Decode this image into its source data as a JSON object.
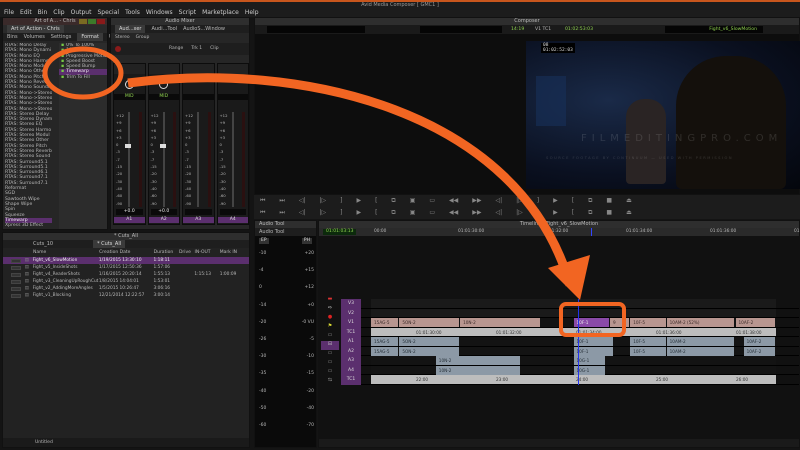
{
  "app": {
    "title": "Avid Media Composer [ GMC1 ]"
  },
  "menu": [
    "File",
    "Edit",
    "Bin",
    "Clip",
    "Output",
    "Special",
    "Tools",
    "Windows",
    "Script",
    "Marketplace",
    "Help"
  ],
  "effects_panel": {
    "title": "Art of A... - Chris",
    "tab": "Art of Action - Chris",
    "tabs": [
      "Bins",
      "Volumes",
      "Settings",
      "Format",
      "Us"
    ],
    "categories": [
      "RTAS: Mono Delay",
      "RTAS: Mono Dynami",
      "RTAS: Mono EQ",
      "RTAS: Mono Harmon",
      "RTAS: Mono Modul",
      "RTAS: Mono Other",
      "RTAS: Mono Pitch",
      "RTAS: Mono Reverb",
      "RTAS: Mono SoundF",
      "RTAS: Mono->Stereo",
      "RTAS: Mono->Stereo",
      "RTAS: Mono->Stereo",
      "RTAS: Mono->Stereo",
      "RTAS: Stereo Delay",
      "RTAS: Stereo Dynam",
      "RTAS: Stereo EQ",
      "RTAS: Stereo Harmo",
      "RTAS: Stereo Modul",
      "RTAS: Stereo Other",
      "RTAS: Stereo Pitch",
      "RTAS: Stereo Reverb",
      "RTAS: Stereo Sound",
      "RTAS: Surround5.1",
      "RTAS: Surround5.1",
      "RTAS: Surround6.1",
      "RTAS: Surround7.1",
      "RTAS: Surround7.1",
      "Reformat",
      "SGD",
      "Sawtooth Wipe",
      "Shape Wipe",
      "Spin",
      "Squeeze",
      "Timewarp",
      "Xpress 3D Effect"
    ],
    "selected_category": "Timewarp",
    "effects": [
      "0% To 100%",
      "100% To 0%",
      "Progressive Motion",
      "Speed Boost",
      "Speed Bump",
      "Timewarp",
      "Trim To Fill"
    ],
    "selected_effect": "Timewarp"
  },
  "audio_mixer": {
    "title": "Audio Mixer",
    "tabs": [
      "Aud...xer",
      "Audi...Tool",
      "AudioS...Window"
    ],
    "stereo_label": "Stereo",
    "group_label": "Group",
    "range_label": "Range",
    "trk_label": "Trk 1",
    "clip_label": "Clip",
    "channels": [
      {
        "pan": "MID",
        "gain": "+0.0",
        "name": "A1"
      },
      {
        "pan": "MID",
        "gain": "+0.0",
        "name": "A2"
      },
      {
        "pan": "",
        "gain": "",
        "name": "A3"
      },
      {
        "pan": "",
        "gain": "",
        "name": "A4"
      }
    ],
    "scale": [
      "+12",
      "+9",
      "+6",
      "+3",
      "0",
      "-3",
      "-7",
      "-15",
      "-20",
      "-30",
      "-40",
      "-60",
      "-90"
    ]
  },
  "composer": {
    "title": "Composer",
    "time": "14:19",
    "track": "V1 TC1",
    "timecode": "01:02:53:03",
    "sequence": "Fight_v6_SlowMotion",
    "overlay_frame": "08",
    "overlay_tc": "01:02:52:03",
    "watermark": "FILMEDITINGPRO.COM",
    "watermark_sub": "SOURCE FOOTAGE BY CONTINUUM — USED WITH PERMISSION"
  },
  "bin": {
    "title": "* Cuts_All",
    "tabs": [
      "Cuts_10",
      "* Cuts_All"
    ],
    "columns": [
      "Name",
      "Creation Date",
      "Duration",
      "Drive",
      "IN-OUT",
      "Mark IN"
    ],
    "rows": [
      [
        "Fight_v6_SlowMotion",
        "1/19/2015 13:30:10",
        "1:18:11",
        "",
        "",
        ""
      ],
      [
        "Fight_v5_InsideShots",
        "1/17/2015 12:50:36",
        "1:57:06",
        "",
        "",
        ""
      ],
      [
        "Fight_v4_ReaderShots",
        "1/16/2015 20:20:14",
        "1:55:13",
        "",
        "1:15:13",
        "1:00:09"
      ],
      [
        "Fight_v3_CleaningUpRoughCut",
        "1/8/2015 14:04:01",
        "1:53:01",
        "",
        "",
        ""
      ],
      [
        "Fight_v2_AddingMoreAngles",
        "1/5/2015 10:26:47",
        "3:06:16",
        "",
        "",
        ""
      ],
      [
        "Fight_v1_Blocking",
        "12/21/2014 12:22:57",
        "3:00:14",
        "",
        "",
        ""
      ]
    ],
    "view": "Untitled"
  },
  "audio_tool": {
    "title": "Audio Tool",
    "tab": "Audio Tool",
    "left": [
      "-10",
      "-4",
      "0",
      "-14",
      "-20",
      "-26",
      "-30",
      "-35",
      "-40",
      "-50",
      "-60"
    ],
    "right": [
      "+20",
      "+15",
      "+12",
      "+0",
      "-0 VU",
      "-5",
      "-10",
      "-15",
      "-20",
      "-40",
      "-70"
    ],
    "btns": [
      "EP",
      "PH"
    ]
  },
  "timeline": {
    "title": "Timeline - Fight_v6_SlowMotion",
    "timecode": "01:01:03:13",
    "ruler": [
      "00:00",
      "01:01:30:00",
      "01:01:32:00",
      "01:01:34:00",
      "01:01:36:00",
      "01:01:38:00"
    ],
    "tracks": [
      "V3",
      "V2",
      "V1",
      "TC1",
      "A1",
      "A2",
      "A3",
      "A4",
      "TC1"
    ],
    "v1": [
      {
        "n": "15AG-5",
        "s": 0,
        "w": 7
      },
      {
        "n": "5ON-2",
        "s": 7,
        "w": 15
      },
      {
        "n": "10N-2",
        "s": 22,
        "w": 20
      },
      {
        "n": "10F-1",
        "s": 50,
        "w": 9,
        "sel": true
      },
      {
        "n": "9",
        "s": 59,
        "w": 5
      },
      {
        "n": "10F-5",
        "s": 64,
        "w": 9
      },
      {
        "n": "10AM-2 (52%)",
        "s": 73,
        "w": 17
      },
      {
        "n": "10AF-2",
        "s": 90,
        "w": 10
      }
    ],
    "a12": [
      {
        "n": "15AG-5",
        "s": 0,
        "w": 7
      },
      {
        "n": "5ON-2",
        "s": 7,
        "w": 15
      },
      {
        "n": "10F-1",
        "s": 50,
        "w": 10
      },
      {
        "n": "10F-5",
        "s": 64,
        "w": 9
      },
      {
        "n": "10AM-2",
        "s": 73,
        "w": 17
      },
      {
        "n": "10AF-2",
        "s": 92,
        "w": 8
      }
    ],
    "a34": [
      {
        "n": "10N-2",
        "s": 16,
        "w": 21
      },
      {
        "n": "10G-1",
        "s": 50,
        "w": 8
      }
    ],
    "tc_ruler": [
      "01:01:30:00",
      "01:01:32:00",
      "01:01:34:00",
      "01:01:36:00",
      "01:01:38:00"
    ],
    "tc_bottom": [
      "22:00",
      "23:00",
      "24:00",
      "25:00",
      "26:00"
    ],
    "playhead_pct": 51
  },
  "colors": {
    "accent": "#5b2f6e",
    "annotation": "#f26522",
    "timecode_green": "#8fd14f"
  }
}
